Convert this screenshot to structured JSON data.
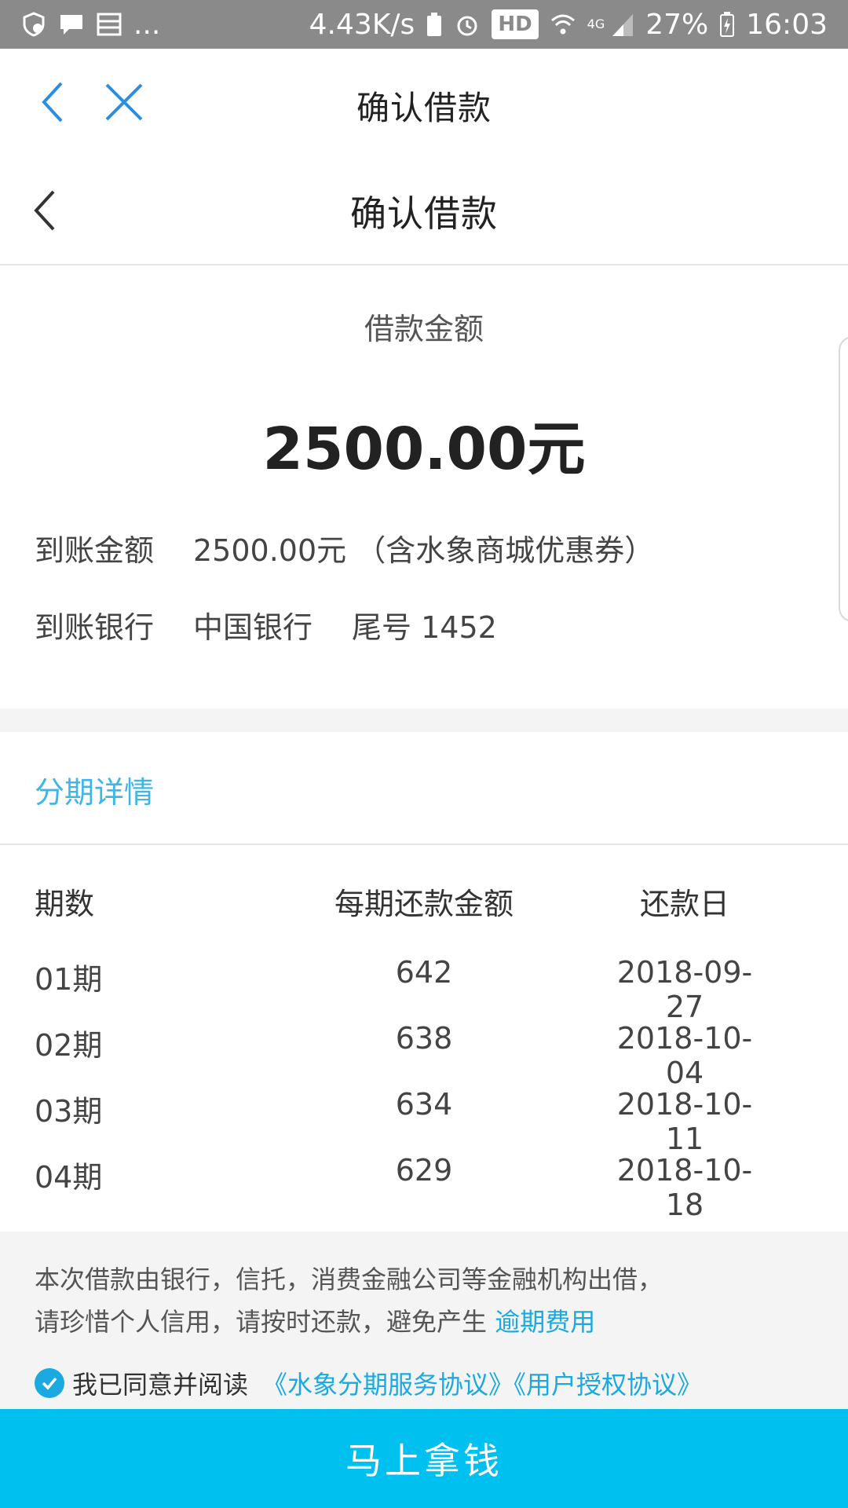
{
  "status_bar": {
    "more": "...",
    "speed": "4.43K/s",
    "hd": "HD",
    "network": "4G",
    "battery": "27%",
    "time": "16:03"
  },
  "outer_nav": {
    "title": "确认借款"
  },
  "inner_nav": {
    "title": "确认借款"
  },
  "loan": {
    "amount_label": "借款金额",
    "amount_value": "2500.00元",
    "arrival_amount_label": "到账金额",
    "arrival_amount_value": "2500.00元 （含水象商城优惠券）",
    "bank_label": "到账银行",
    "bank_name": "中国银行",
    "bank_tail": "尾号 1452"
  },
  "installments": {
    "title": "分期详情",
    "headers": [
      "期数",
      "每期还款金额",
      "还款日"
    ],
    "rows": [
      {
        "period": "01期",
        "amount": "642",
        "date": "2018-09-27"
      },
      {
        "period": "02期",
        "amount": "638",
        "date": "2018-10-04"
      },
      {
        "period": "03期",
        "amount": "634",
        "date": "2018-10-11"
      },
      {
        "period": "04期",
        "amount": "629",
        "date": "2018-10-18"
      }
    ]
  },
  "notice": {
    "line1": "本次借款由银行，信托，消费金融公司等金融机构出借，",
    "line2": "请珍惜个人信用，请按时还款，避免产生",
    "overdue_link": "逾期费用",
    "agree_text": "我已同意并阅读",
    "agreement_links": "《水象分期服务协议》《用户授权协议》"
  },
  "cta": {
    "label": "马上拿钱"
  },
  "colors": {
    "accent": "#00c0ef",
    "link": "#1aa9e0",
    "section_title": "#3fb6e6",
    "status_bar": "#8a8a8a"
  }
}
